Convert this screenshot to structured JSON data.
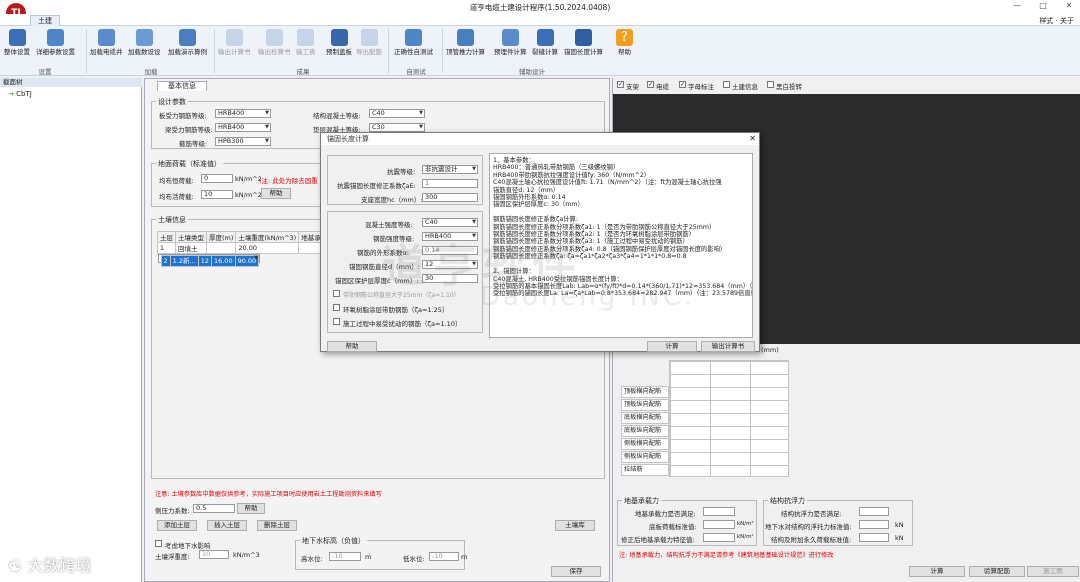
{
  "window": {
    "title": "道亨电缆土建设计程序(1.50.2024.0408)",
    "logo": "TJ"
  },
  "menu": {
    "tab": "土建",
    "style": "样式 · 关于"
  },
  "ribbon": {
    "groups": [
      "设置",
      "加载",
      "成果",
      "自测试",
      "辅助设计"
    ],
    "buttons": [
      "整体设置",
      "详细参数设置",
      "加载电缆井",
      "加载数设设",
      "加载演示算例",
      "输出计算书",
      "输出检算书",
      "输工表",
      "预制盖板",
      "导出配筋",
      "正确性自测试",
      "顶管推力计算",
      "预埋件计算",
      "裂缝计算",
      "锚固长度计算",
      "帮助"
    ]
  },
  "tree": {
    "header": "截面树",
    "root": "CbTJ"
  },
  "main": {
    "tab": "基本信息",
    "design": {
      "legend": "设计参数",
      "rows": [
        {
          "label": "板受力钢筋等级:",
          "value": "HRB400"
        },
        {
          "label": "梁受力钢筋等级:",
          "value": "HRB400"
        },
        {
          "label": "箍筋等级:",
          "value": "HPB300"
        }
      ],
      "rows2": [
        {
          "label": "结构混凝土等级:",
          "value": "C40"
        },
        {
          "label": "垫层混凝土等级:",
          "value": "C30"
        }
      ]
    },
    "load": {
      "legend": "地面荷载（标准值）",
      "dead_label": "均布恒荷载:",
      "dead_value": "0",
      "dead_unit": "kN/m^2",
      "note": "(注: 此处为除去固重",
      "live_label": "均布活荷载:",
      "live_value": "10",
      "live_unit": "kN/m^2",
      "help": "帮助"
    },
    "soil": {
      "legend": "土壤信息",
      "headers": [
        "土层",
        "土壤类型",
        "厚度(m)",
        "土壤重度(kN/m^3)",
        "地基承"
      ],
      "rows": [
        [
          "1",
          "回填土",
          "",
          "20.00",
          ""
        ],
        [
          "2",
          "1.2新...",
          "12",
          "16.00",
          "90.00"
        ]
      ],
      "note": "注意: 土壤参数库中数据仅供参考，实际施工项目时应使用岩土工程勘测资料来填写",
      "pressure_label": "侧压力系数:",
      "pressure_value": "0.5",
      "help": "帮助",
      "add": "添加土层",
      "insert": "插入土层",
      "delete": "删除土层",
      "library": "土壤库"
    },
    "ground": {
      "check_label": "考虑地下水影响",
      "float_label": "土壤浮重度:",
      "float_value": "10",
      "float_unit": "kN/m^3",
      "water_legend": "地下水标高（负值）",
      "high_label": "高水位:",
      "high_value": "-10",
      "high_unit": "m",
      "low_label": "低水位:",
      "low_value": "-10",
      "low_unit": "m"
    },
    "save": "保存"
  },
  "right": {
    "checks": [
      "支架",
      "电缆",
      "字母标注",
      "土建信息",
      "黑白投转"
    ],
    "unit": "(mm)",
    "rebar_rows": [
      "顶板横向配筋",
      "顶板纵向配筋",
      "底板横向配筋",
      "底板纵向配筋",
      "侧板横向配筋",
      "侧板纵向配筋",
      "拉结筋"
    ],
    "bearing": {
      "legend": "地基承载力",
      "l1": "地基承载力是否满足:",
      "l2": "底板荷载标准值:",
      "u2": "kN/m²",
      "l3": "修正后地基承载力特征值:",
      "u3": "kN/m²"
    },
    "antifloat": {
      "legend": "结构抗浮力",
      "l1": "结构抗浮力是否满足:",
      "l2": "地下水对结构的浮托力标准值:",
      "u2": "kN",
      "l3": "结构及附加永久荷载标准值:",
      "u3": "kN"
    },
    "note": "注: 地基承载力，结构抗浮力不满足请参考《建筑地基基础设计规范》进行修改",
    "calc": "计算",
    "check": "验算配筋",
    "scheme": "施工图"
  },
  "dialog": {
    "title": "锚固长度计算",
    "seismic_label": "抗震等级:",
    "seismic_value": "非抗震设计",
    "seismic_coef_label": "抗震锚固长度修正系数ζaE:",
    "seismic_coef_value": "1",
    "support_label": "支座宽度hc（mm）:",
    "support_value": "300",
    "concrete_label": "混凝土强度等级:",
    "concrete_value": "C40",
    "steel_label": "钢筋强度等级:",
    "steel_value": "HRB400",
    "shape_label": "钢筋的外形系数α:",
    "shape_value": "0.14",
    "dia_label": "锚固钢筋直径d（mm）:",
    "dia_value": "12",
    "cover_label": "锚固区保护层厚度c（mm）:",
    "cover_value": "30",
    "opt1": "带肋钢筋公称直径大于25mm（ζa=1.10）",
    "opt2": "环氧树脂涂层带肋钢筋（ζa=1.25）",
    "opt3": "施工过程中易受扰动的钢筋（ζa=1.10）",
    "help": "帮助",
    "calc": "计算",
    "export": "输出计算书",
    "result": [
      "1、基本参数：",
      "HRB400：普通热轧带肋钢筋（三级螺纹钢）",
      "HRB400带肋钢筋抗拉强度设计值fy: 360（N/mm^2）",
      "C40混凝土轴心抗拉强度设计值ft: 1.71（N/mm^2）（注：ft为混凝土轴心抗拉强",
      "锚筋直径d: 12（mm）",
      "锚固钢筋外形系数α: 0.14",
      "锚固区保护层厚度c: 30（mm）",
      "",
      "钢筋锚固长度修正系数ζa计算:",
      "钢筋锚固长度修正系数分项系数ζa1: 1（是否为带肋钢筋公称直径大于25mm）",
      "钢筋锚固长度修正系数分项系数ζa2: 1（是否为环氧树脂涂层带肋钢筋）",
      "钢筋锚固长度修正系数分项系数ζa3: 1（施工过程中易受扰动的钢筋）",
      "钢筋锚固长度修正系数分项系数ζa4: 0.8（锚固钢筋保护层厚度对锚固长度的影响）",
      "钢筋锚固长度修正系数ζa: ζa=ζa1*ζa2*ζa3*ζa4=1*1*1*0.8=0.8",
      "",
      "2、锚固计算：",
      "C40混凝土, HRB400受拉钢筋锚固长度计算：",
      "受拉钢筋的基本锚固长度Lab: Lab=α*(fy/ft)*d=0.14*(360/1.71)*12=353.684（mm）（",
      "受拉钢筋的锚固长度La: La=ζa*Lab=0.8*353.684=282.947（mm）（注：23.5789倍直径"
    ]
  },
  "overlay": {
    "watermark": "道亨软件",
    "watermark_en": "Daoheng INC.",
    "brand": "大数跨境"
  }
}
